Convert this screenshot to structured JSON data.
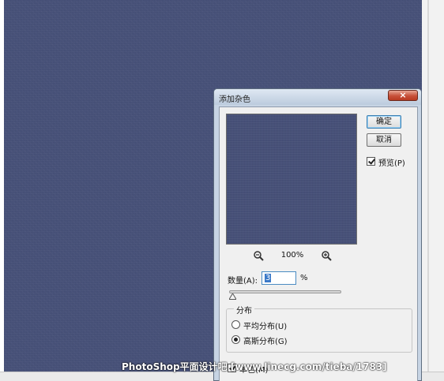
{
  "dialog": {
    "title": "添加杂色",
    "close_glyph": "×",
    "ok_label": "确定",
    "cancel_label": "取消",
    "preview_label": "预览(P)",
    "preview_checked": true,
    "zoom_level": "100%",
    "amount_label": "数量(A):",
    "amount_value": "3",
    "amount_unit": "%",
    "distribution": {
      "label": "分布",
      "options": [
        {
          "label": "平均分布(U)",
          "selected": false
        },
        {
          "label": "高斯分布(G)",
          "selected": true
        }
      ]
    },
    "monochrome_label": "单色(M)",
    "monochrome_checked": true
  },
  "watermark": "PhotoShop平面设计吧  [www.linecg.com/tieba/1783]",
  "colors": {
    "canvas": "#48527a",
    "dialog_frame": "#c7d4e4",
    "close_button": "#c75039",
    "dialog_face": "#f0f0f0"
  },
  "icons": [
    "zoom-out-icon",
    "zoom-in-icon",
    "checkmark-icon",
    "close-icon"
  ]
}
